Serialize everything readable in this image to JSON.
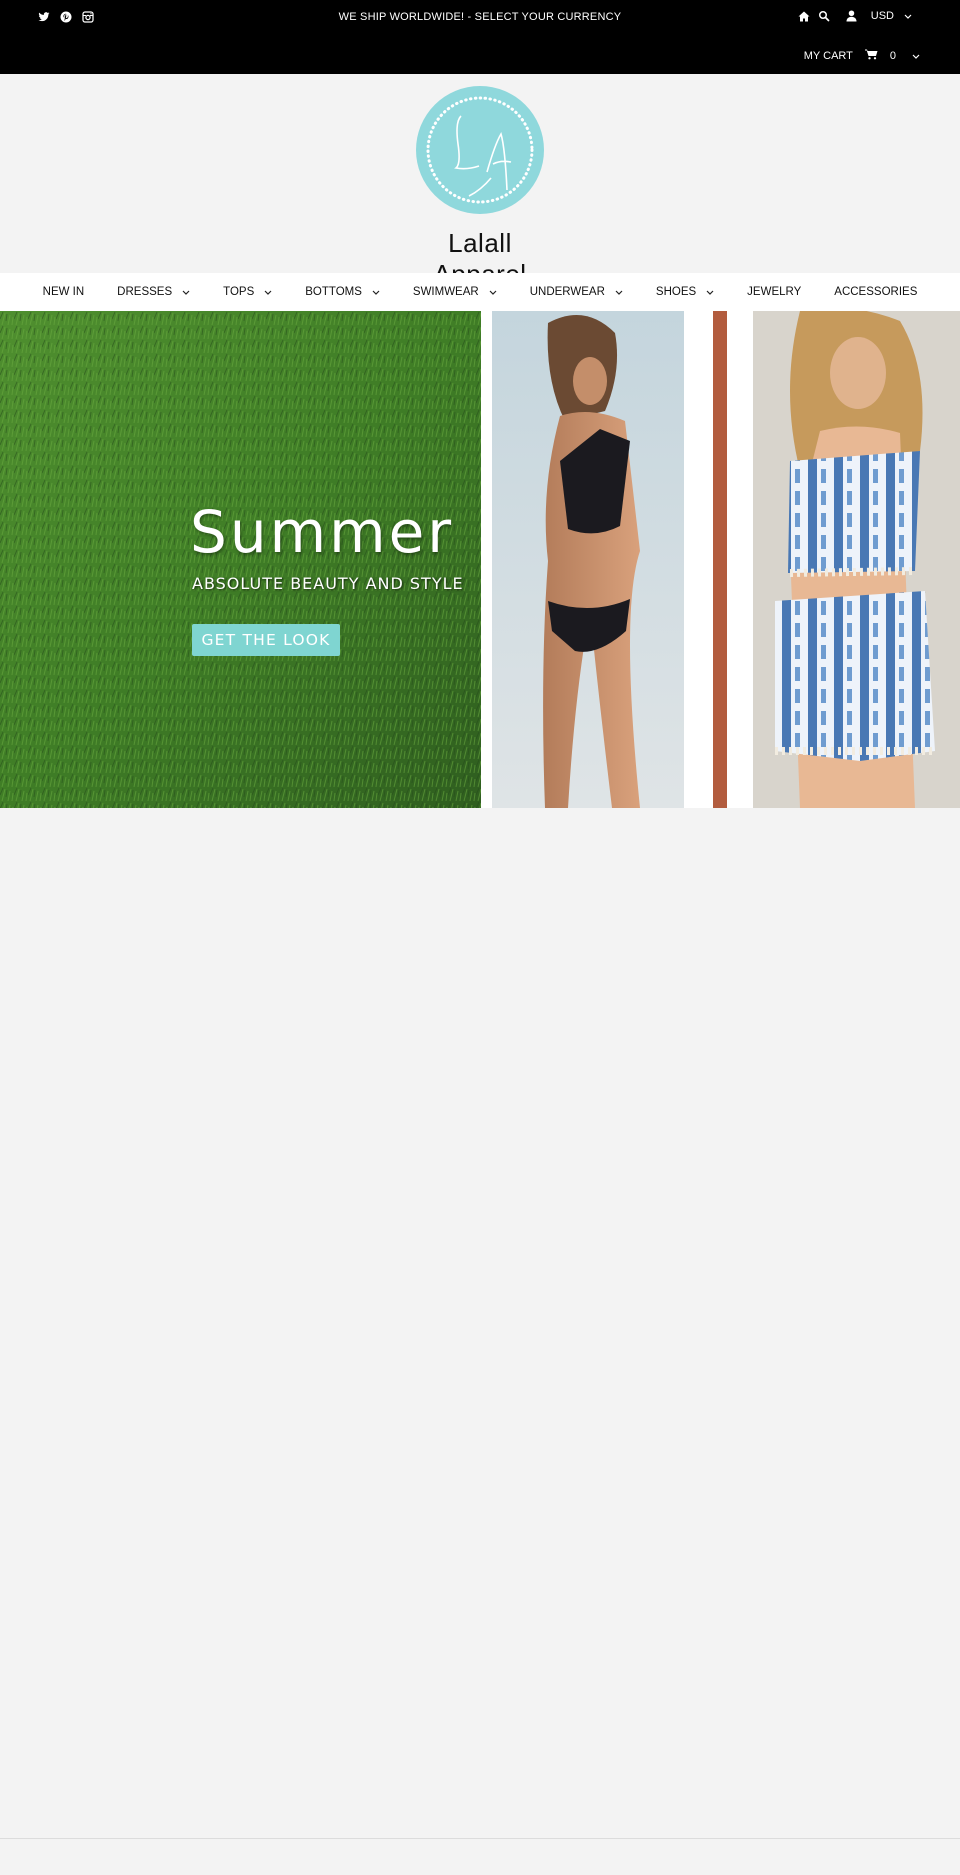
{
  "topbar": {
    "social_icons": [
      "twitter-icon",
      "pinterest-icon",
      "instagram-icon"
    ],
    "announcement": "WE SHIP WORLDWIDE! - SELECT YOUR CURRENCY",
    "tool_icons": [
      "home-icon",
      "search-icon",
      "user-icon"
    ],
    "currency": "USD",
    "cart_label": "MY CART",
    "cart_count": "0"
  },
  "brand": {
    "monogram": "LA",
    "name": "Lalall Apparel",
    "accent_color": "#8fd8dc"
  },
  "nav": {
    "items": [
      {
        "label": "NEW IN",
        "dropdown": false
      },
      {
        "label": "DRESSES",
        "dropdown": true
      },
      {
        "label": "TOPS",
        "dropdown": true
      },
      {
        "label": "BOTTOMS",
        "dropdown": true
      },
      {
        "label": "SWIMWEAR",
        "dropdown": true
      },
      {
        "label": "UNDERWEAR",
        "dropdown": true
      },
      {
        "label": "SHOES",
        "dropdown": true
      },
      {
        "label": "JEWELRY",
        "dropdown": false
      },
      {
        "label": "ACCESSORIES",
        "dropdown": false
      }
    ]
  },
  "hero": {
    "title": "Summer",
    "subtitle": "ABSOLUTE BEAUTY AND STYLE",
    "cta_label": "GET THE LOOK",
    "cta_color": "#7fd5d1"
  }
}
